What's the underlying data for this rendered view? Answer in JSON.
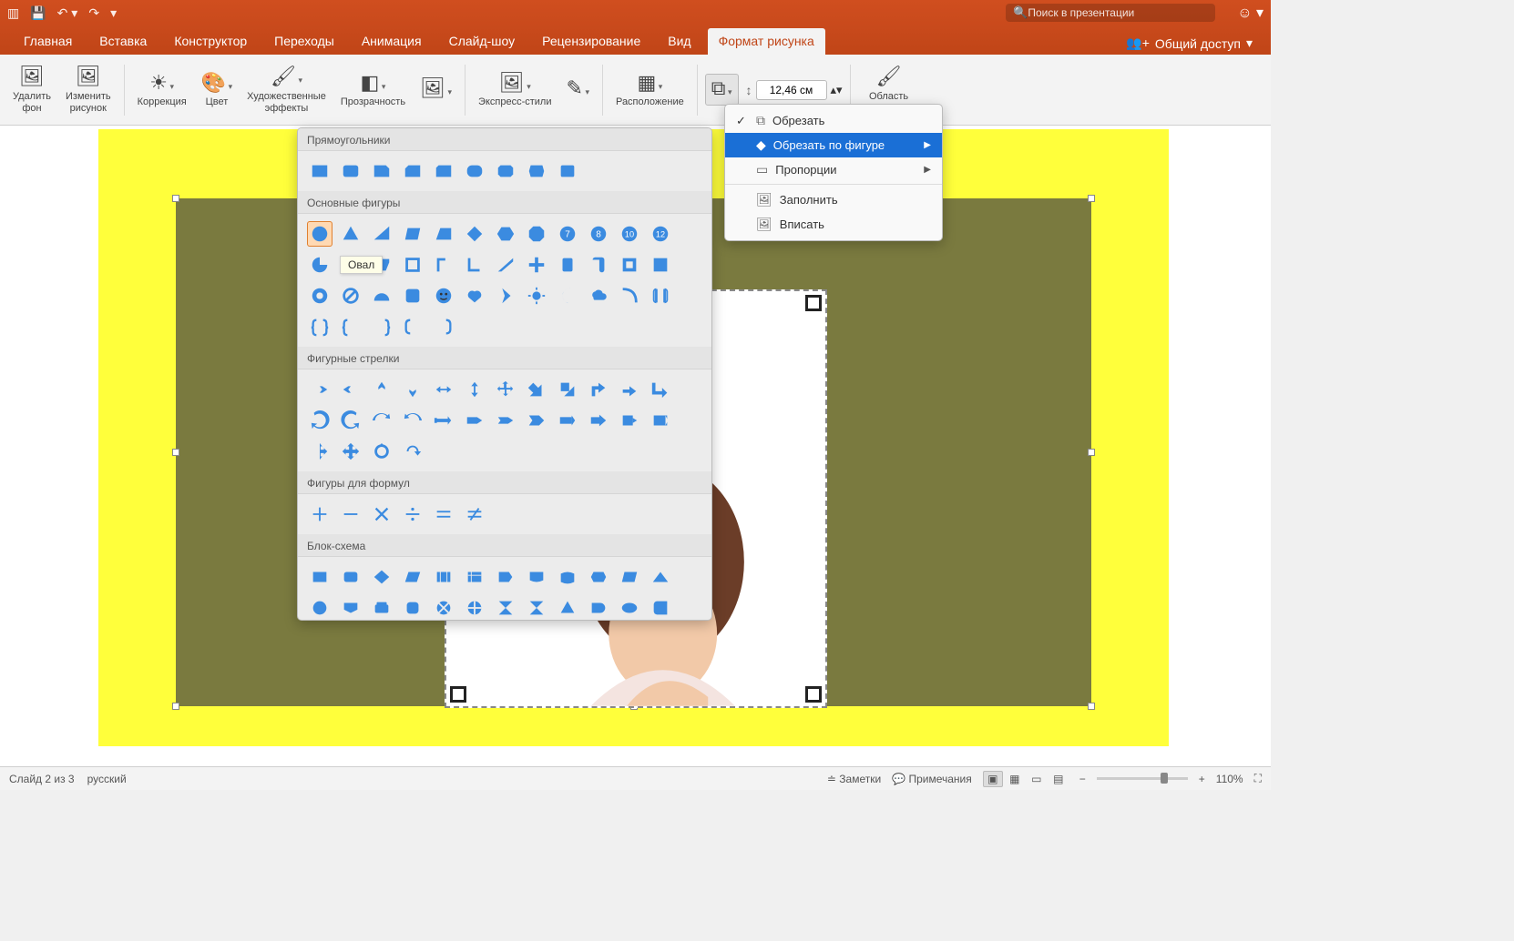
{
  "search": {
    "placeholder": "Поиск в презентации"
  },
  "tabs": {
    "home": "Главная",
    "insert": "Вставка",
    "design": "Конструктор",
    "transitions": "Переходы",
    "animations": "Анимация",
    "slideshow": "Слайд-шоу",
    "review": "Рецензирование",
    "view": "Вид",
    "picformat": "Формат рисунка",
    "share": "Общий доступ"
  },
  "ribbon": {
    "remove_bg": "Удалить\nфон",
    "change_pic": "Изменить\nрисунок",
    "corrections": "Коррекция",
    "color": "Цвет",
    "artistic": "Художественные\nэффекты",
    "transparency": "Прозрачность",
    "quick_styles": "Экспресс-стили",
    "arrange": "Расположение",
    "crop_area": "Область\nвырования",
    "height_value": "12,46 см"
  },
  "crop_menu": {
    "crop": "Обрезать",
    "by_shape": "Обрезать по фигуре",
    "aspect": "Пропорции",
    "fill": "Заполнить",
    "fit": "Вписать"
  },
  "shapes": {
    "cat_rectangles": "Прямоугольники",
    "cat_basic": "Основные фигуры",
    "cat_arrows": "Фигурные стрелки",
    "cat_equation": "Фигуры для формул",
    "cat_flowchart": "Блок-схема",
    "tooltip_oval": "Овал",
    "rectangles": 9,
    "basic_rows": [
      12,
      12,
      12,
      5
    ],
    "arrows_rows": [
      12,
      12,
      4
    ],
    "equation": 6,
    "flowchart_rows": [
      12,
      12
    ]
  },
  "status": {
    "slide": "Слайд 2 из 3",
    "lang": "русский",
    "notes": "Заметки",
    "comments": "Примечания",
    "zoom": "110%"
  }
}
